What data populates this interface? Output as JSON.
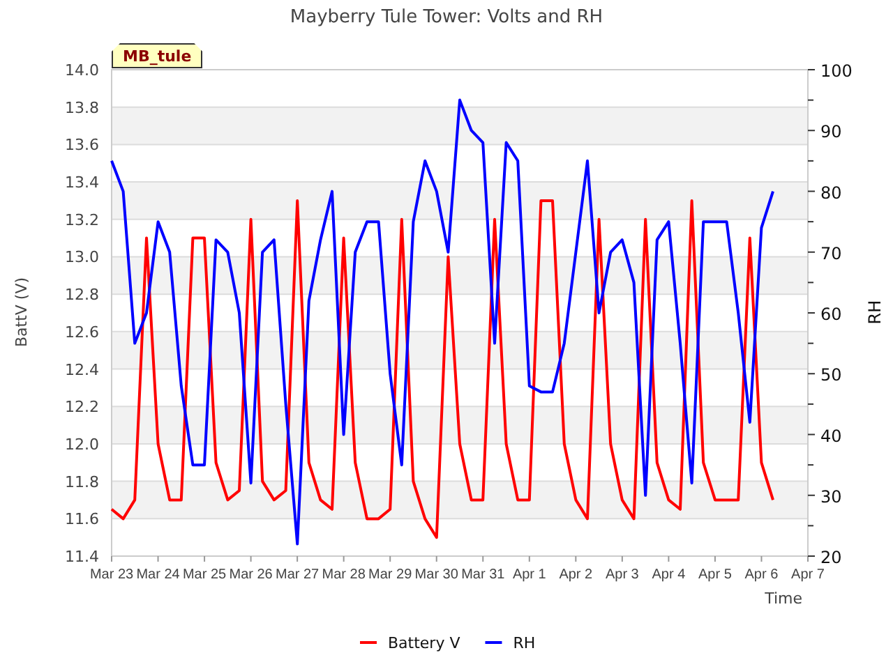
{
  "chart": {
    "badge": "MB_tule",
    "chart_data": {
      "type": "line",
      "title": "Mayberry Tule Tower: Volts and RH",
      "xlabel": "Time",
      "ylabel": "BattV (V)",
      "y2label": "RH",
      "categories": [
        "Mar 23",
        null,
        null,
        null,
        "Mar 24",
        null,
        null,
        null,
        "Mar 25",
        null,
        null,
        null,
        "Mar 26",
        null,
        null,
        null,
        "Mar 27",
        null,
        null,
        null,
        "Mar 28",
        null,
        null,
        null,
        "Mar 29",
        null,
        null,
        null,
        "Mar 30",
        null,
        null,
        null,
        "Mar 31",
        null,
        null,
        null,
        "Apr 1",
        null,
        null,
        null,
        "Apr 2",
        null,
        null,
        null,
        "Apr 3",
        null,
        null,
        null,
        "Apr 4",
        null,
        null,
        null,
        "Apr 5",
        null,
        null,
        null,
        "Apr 6",
        null,
        null,
        null,
        "Apr 7"
      ],
      "series": [
        {
          "name": "Battery V",
          "color": "#ff0000",
          "values": [
            11.65,
            11.6,
            11.7,
            13.1,
            12.0,
            11.7,
            11.7,
            13.1,
            13.1,
            11.9,
            11.7,
            11.75,
            13.2,
            11.8,
            11.7,
            11.75,
            13.3,
            11.9,
            11.7,
            11.65,
            13.1,
            11.9,
            11.6,
            11.6,
            11.65,
            13.2,
            11.8,
            11.6,
            11.5,
            13.0,
            12.0,
            11.7,
            11.7,
            13.2,
            12.0,
            11.7,
            11.7,
            13.3,
            13.3,
            12.0,
            11.7,
            11.6,
            13.2,
            12.0,
            11.7,
            11.6,
            13.2,
            11.9,
            11.7,
            11.65,
            13.3,
            11.9,
            11.7,
            11.7,
            11.7,
            13.1,
            11.9,
            11.7,
            null,
            null,
            null
          ]
        },
        {
          "name": "RH",
          "color": "#0000ff",
          "axis": "y2",
          "values": [
            85,
            80,
            55,
            60,
            75,
            70,
            48,
            35,
            35,
            72,
            70,
            60,
            32,
            70,
            72,
            45,
            22,
            62,
            72,
            80,
            40,
            70,
            75,
            75,
            50,
            35,
            75,
            85,
            80,
            70,
            95,
            90,
            88,
            55,
            88,
            85,
            48,
            47,
            47,
            55,
            70,
            85,
            60,
            70,
            72,
            65,
            30,
            72,
            75,
            55,
            32,
            75,
            75,
            75,
            60,
            42,
            74,
            80,
            null,
            null,
            null
          ]
        }
      ],
      "grid": true,
      "legend": "bottom",
      "ylim": [
        11.4,
        14.0
      ],
      "y2lim": [
        20,
        100
      ],
      "yticks": [
        {
          "value": 11.4,
          "label": "11.4"
        },
        {
          "value": 11.6,
          "label": "11.6"
        },
        {
          "value": 11.8,
          "label": "11.8"
        },
        {
          "value": 12.0,
          "label": "12.0"
        },
        {
          "value": 12.2,
          "label": "12.2"
        },
        {
          "value": 12.4,
          "label": "12.4"
        },
        {
          "value": 12.6,
          "label": "12.6"
        },
        {
          "value": 12.8,
          "label": "12.8"
        },
        {
          "value": 13.0,
          "label": "13.0"
        },
        {
          "value": 13.2,
          "label": "13.2"
        },
        {
          "value": 13.4,
          "label": "13.4"
        },
        {
          "value": 13.6,
          "label": "13.6"
        },
        {
          "value": 13.8,
          "label": "13.8"
        },
        {
          "value": 14.0,
          "label": "14.0"
        }
      ],
      "y2ticks": [
        20,
        30,
        40,
        50,
        60,
        70,
        80,
        90,
        100
      ]
    }
  }
}
